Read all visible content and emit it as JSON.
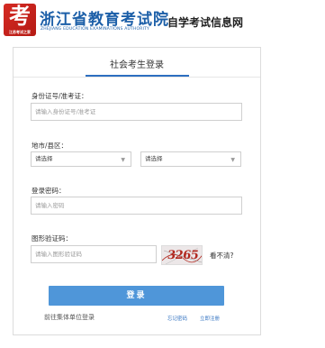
{
  "header": {
    "logo_big": "考",
    "logo_small": "江苏考试之家",
    "site_name": "浙江省教育考试院",
    "site_sub": "ZHEJIANG EDUCATION EXAMINATIONS AUTHORITY",
    "site_tag": "自学考试信息网"
  },
  "login": {
    "title": "社会考生登录",
    "id_label": "身份证号/准考证：",
    "id_placeholder": "请输入身份证号/准考证",
    "region_label": "地市/县区：",
    "city_value": "请选择",
    "district_value": "请选择",
    "password_label": "登录密码：",
    "password_placeholder": "请输入密码",
    "captcha_label": "图形验证码：",
    "captcha_placeholder": "请输入图形验证码",
    "captcha_text": "3265",
    "refresh_text": "看不清?",
    "login_button": "登录",
    "group_login_link": "前往集体单位登录",
    "forgot_password_link": "忘记密码",
    "register_link": "立即注册"
  },
  "colors": {
    "brand_blue": "#1c5fa8",
    "button_blue": "#4f96d9",
    "logo_red": "#d52a23"
  },
  "icons": {
    "chevron": "chevron-down-icon"
  }
}
